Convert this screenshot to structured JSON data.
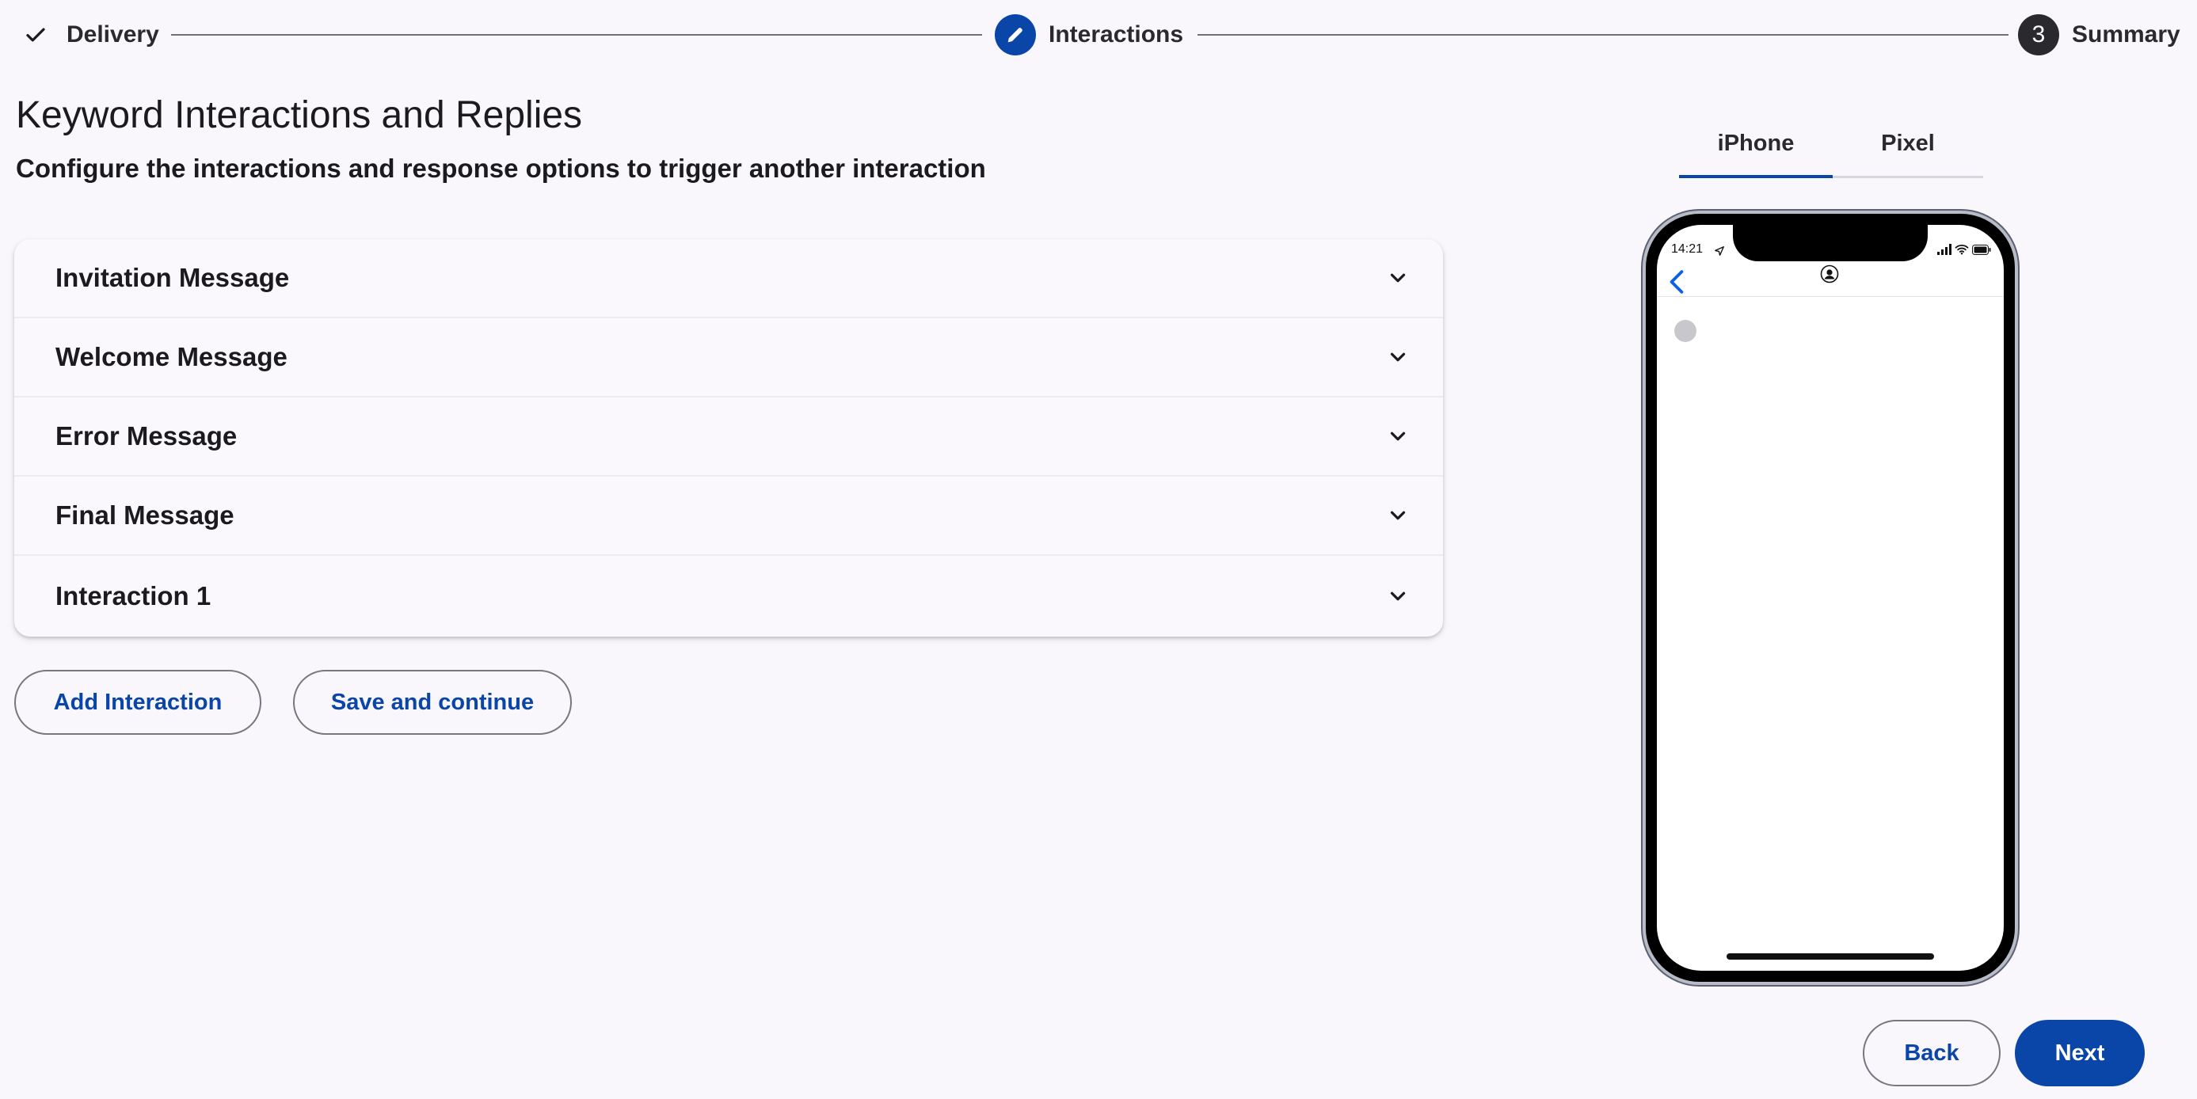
{
  "stepper": {
    "steps": [
      {
        "label": "Delivery",
        "state": "completed",
        "icon": "check-icon"
      },
      {
        "label": "Interactions",
        "state": "active",
        "icon": "pencil-icon"
      },
      {
        "label": "Summary",
        "state": "pending",
        "number": "3"
      }
    ]
  },
  "page": {
    "title": "Keyword Interactions and Replies",
    "subtitle": "Configure the interactions and response options to trigger another interaction"
  },
  "accordion": {
    "items": [
      {
        "label": "Invitation Message"
      },
      {
        "label": "Welcome Message"
      },
      {
        "label": "Error Message"
      },
      {
        "label": "Final Message"
      },
      {
        "label": "Interaction 1"
      }
    ]
  },
  "actions": {
    "add_interaction": "Add Interaction",
    "save_and_continue": "Save and continue"
  },
  "preview": {
    "tabs": [
      {
        "label": "iPhone",
        "selected": true
      },
      {
        "label": "Pixel",
        "selected": false
      }
    ],
    "phone": {
      "status_time": "14:21"
    }
  },
  "footer": {
    "back": "Back",
    "next": "Next"
  },
  "colors": {
    "accent": "#0a45a8",
    "background": "#f9f7fc",
    "step_active": "#0a45a8",
    "step_pending": "#2a2a2e"
  }
}
